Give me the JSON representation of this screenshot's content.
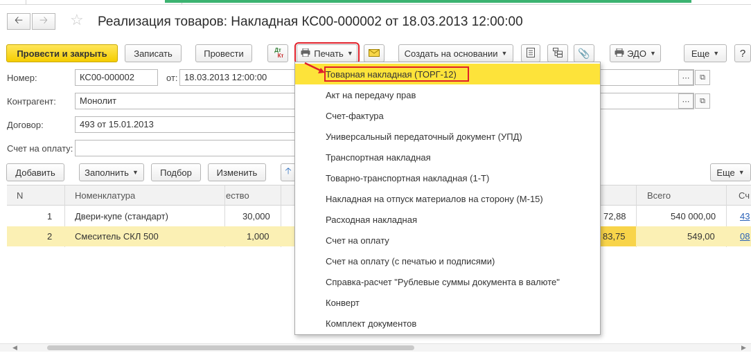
{
  "title": "Реализация товаров: Накладная КС00-000002 от 18.03.2013 12:00:00",
  "nav": {
    "back_icon": "arrow-left-icon",
    "forward_icon": "arrow-right-icon",
    "star_icon": "star-icon"
  },
  "toolbar": {
    "post_close": "Провести и закрыть",
    "save": "Записать",
    "post": "Провести",
    "dt_kt": "Дт",
    "kt": "Кт",
    "print": "Печать",
    "create_based": "Создать на основании",
    "edo": "ЭДО",
    "more": "Еще"
  },
  "form": {
    "number_label": "Номер:",
    "number_value": "КС00-000002",
    "date_label": "от:",
    "date_value": "18.03.2013 12:00:00",
    "counterparty_label": "Контрагент:",
    "counterparty_value": "Монолит",
    "contract_label": "Договор:",
    "contract_value": "493 от 15.01.2013",
    "invoice_label": "Счет на оплату:",
    "invoice_value": ""
  },
  "table_toolbar": {
    "add": "Добавить",
    "fill": "Заполнить",
    "pick": "Подбор",
    "change": "Изменить",
    "more": "Еще"
  },
  "table": {
    "headers": {
      "n": "N",
      "nomenclature": "Номенклатура",
      "qty": "ество",
      "total": "Всего",
      "invoice": "Сч"
    },
    "rows": [
      {
        "n": "1",
        "name": "Двери-купе (стандарт)",
        "qty": "30,000",
        "price_part": "72,88",
        "total": "540 000,00",
        "invoice": "43"
      },
      {
        "n": "2",
        "name": "Смеситель СКЛ 500",
        "qty": "1,000",
        "price_part": "83,75",
        "total": "549,00",
        "invoice": "08"
      }
    ]
  },
  "print_menu": [
    "Товарная накладная (ТОРГ-12)",
    "Акт на передачу прав",
    "Счет-фактура",
    "Универсальный передаточный документ (УПД)",
    "Транспортная накладная",
    "Товарно-транспортная накладная (1-Т)",
    "Накладная на отпуск материалов на сторону (М-15)",
    "Расходная накладная",
    "Счет на оплату",
    "Счет на оплату (с печатью и подписями)",
    "Справка-расчет \"Рублевые суммы документа в валюте\"",
    "Конверт",
    "Комплект документов"
  ],
  "colors": {
    "accent_yellow": "#f5cd00",
    "highlight_red": "#e0202a",
    "selection": "#fbf0b4"
  }
}
